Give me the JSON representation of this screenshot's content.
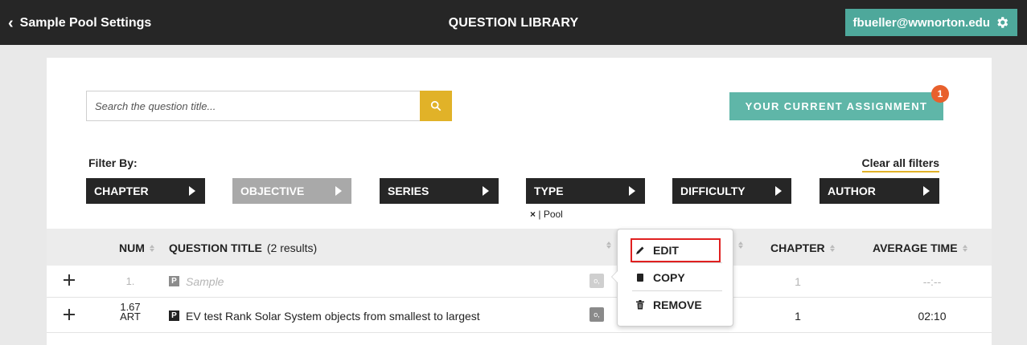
{
  "topbar": {
    "back_label": "Sample Pool Settings",
    "title": "QUESTION LIBRARY",
    "user_email": "fbueller@wwnorton.edu"
  },
  "search": {
    "placeholder": "Search the question title..."
  },
  "assignment": {
    "label": "YOUR CURRENT ASSIGNMENT",
    "badge_count": "1"
  },
  "filters": {
    "label": "Filter By:",
    "clear_label": "Clear all filters",
    "items": [
      {
        "label": "CHAPTER",
        "enabled": true
      },
      {
        "label": "OBJECTIVE",
        "enabled": false
      },
      {
        "label": "SERIES",
        "enabled": true
      },
      {
        "label": "TYPE",
        "enabled": true
      },
      {
        "label": "DIFFICULTY",
        "enabled": true
      },
      {
        "label": "AUTHOR",
        "enabled": true
      }
    ],
    "active_tag": {
      "remove": "×",
      "separator": "|",
      "value": "Pool"
    }
  },
  "table": {
    "headers": {
      "num": "NUM",
      "title": "QUESTION TITLE",
      "results": "(2 results)",
      "chapter": "CHAPTER",
      "avg_time": "AVERAGE TIME"
    },
    "rows": [
      {
        "num_line1": "1.",
        "num_line2": "",
        "type": "P",
        "title": "Sample",
        "key": "o,",
        "chapter": "1",
        "avg_time": "--:--"
      },
      {
        "num_line1": "1.67",
        "num_line2": "ART",
        "type": "P",
        "title": "EV test Rank Solar System objects from smallest to largest",
        "key": "o,",
        "chapter": "1",
        "avg_time": "02:10"
      }
    ]
  },
  "menu": {
    "edit": "EDIT",
    "copy": "COPY",
    "remove": "REMOVE"
  },
  "colors": {
    "topbar": "#262626",
    "user_button": "#4ea89b",
    "search_button": "#e1b228",
    "assignment_button": "#5fb6a8",
    "badge": "#e8602c",
    "edit_highlight": "#e02020"
  }
}
